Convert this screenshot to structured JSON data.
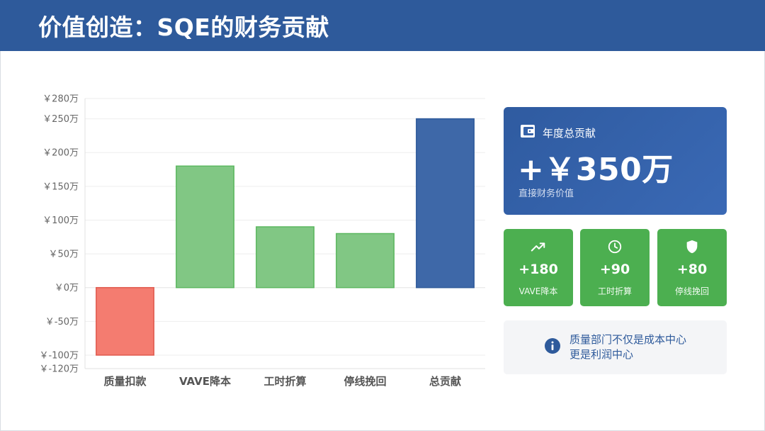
{
  "header": {
    "title": "价值创造：SQE的财务贡献"
  },
  "chart_data": {
    "type": "bar",
    "categories": [
      "质量扣款",
      "VAVE降本",
      "工时折算",
      "停线挽回",
      "总贡献"
    ],
    "values": [
      -100,
      180,
      90,
      80,
      250
    ],
    "bar_colors": [
      "#f47c70",
      "#81c784",
      "#81c784",
      "#81c784",
      "#3e68a8"
    ],
    "bar_borders": [
      "#e05a4e",
      "#5cb860",
      "#5cb860",
      "#5cb860",
      "#2f5a9a"
    ],
    "y_ticks": [
      280,
      250,
      200,
      150,
      100,
      50,
      0,
      -50,
      -100,
      -120
    ],
    "y_tick_labels": [
      "￥280万",
      "￥250万",
      "￥200万",
      "￥150万",
      "￥100万",
      "￥50万",
      "￥0万",
      "￥-50万",
      "￥-100万",
      "￥-120万"
    ],
    "ylim": [
      -120,
      280
    ],
    "title": "",
    "xlabel": "",
    "ylabel": "",
    "grid": true
  },
  "summary": {
    "icon": "wallet-icon",
    "title": "年度总贡献",
    "value": "+￥350万",
    "subtitle": "直接财务价值"
  },
  "metrics": [
    {
      "icon": "trending-up-icon",
      "value": "+180",
      "label": "VAVE降本"
    },
    {
      "icon": "clock-icon",
      "value": "+90",
      "label": "工时折算"
    },
    {
      "icon": "shield-icon",
      "value": "+80",
      "label": "停线挽回"
    }
  ],
  "note": {
    "icon": "info-icon",
    "line1": "质量部门不仅是成本中心",
    "line2": "更是利润中心"
  },
  "colors": {
    "header": "#2e5a9b",
    "metric_green": "#4caf50",
    "accent_blue": "#2e5a9b"
  }
}
